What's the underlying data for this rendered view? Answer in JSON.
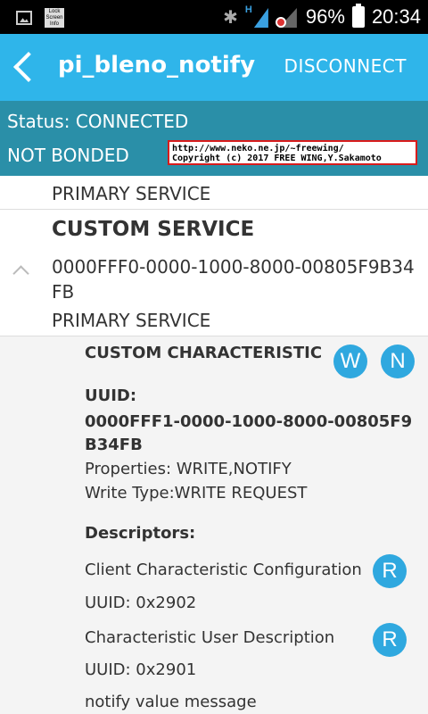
{
  "statusbar": {
    "icons": [
      "image-icon",
      "lock-screen-info-icon",
      "bluetooth-icon",
      "signal-h-icon",
      "signal-no-sim-icon",
      "battery-icon"
    ],
    "lock_label": "Lock Screen Info",
    "network_type": "H",
    "battery": "96%",
    "time": "20:34"
  },
  "appbar": {
    "title": "pi_bleno_notify",
    "action": "DISCONNECT",
    "color": "#2fb5ea"
  },
  "status": {
    "connection": "Status: CONNECTED",
    "bond": "NOT BONDED",
    "color": "#2a8fa8"
  },
  "overlay": {
    "line1": "http://www.neko.ne.jp/~freewing/",
    "line2": "Copyright (c) 2017 FREE WING,Y.Sakamoto"
  },
  "services": [
    {
      "type": "PRIMARY SERVICE"
    },
    {
      "name": "CUSTOM SERVICE",
      "uuid": "0000FFF0-0000-1000-8000-00805F9B34FB",
      "type": "PRIMARY SERVICE"
    }
  ],
  "characteristic": {
    "name": "CUSTOM CHARACTERISTIC",
    "write_btn": "W",
    "notify_btn": "N",
    "uuid_label": "UUID:",
    "uuid": "0000FFF1-0000-1000-8000-00805F9B34FB",
    "properties": "Properties: WRITE,NOTIFY",
    "write_type": "Write Type:WRITE REQUEST",
    "descriptors_label": "Descriptors:",
    "descriptors": [
      {
        "name": "Client Characteristic Configuration",
        "uuid": "UUID: 0x2902",
        "read_btn": "R"
      },
      {
        "name": "Characteristic User Description",
        "uuid": "UUID: 0x2901",
        "read_btn": "R",
        "value": "notify value message"
      }
    ]
  }
}
